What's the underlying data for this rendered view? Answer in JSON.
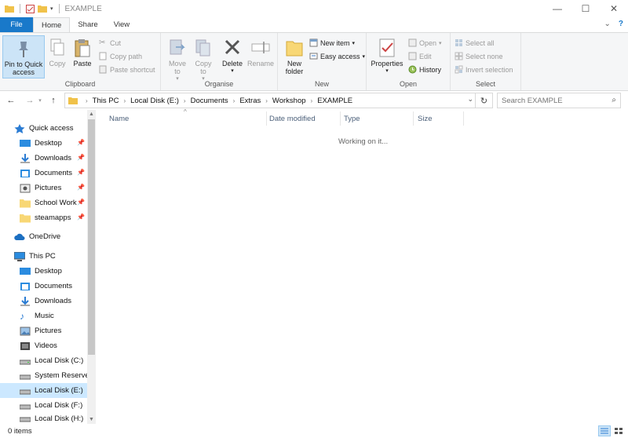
{
  "window": {
    "title": "EXAMPLE"
  },
  "tabs": [
    {
      "label": "File"
    },
    {
      "label": "Home"
    },
    {
      "label": "Share"
    },
    {
      "label": "View"
    }
  ],
  "ribbon": {
    "clipboard": {
      "label": "Clipboard",
      "pin_label": "Pin to Quick access",
      "copy_label": "Copy",
      "paste_label": "Paste",
      "cut_label": "Cut",
      "copy_path_label": "Copy path",
      "paste_shortcut_label": "Paste shortcut"
    },
    "organise": {
      "label": "Organise",
      "move_to_label": "Move to",
      "copy_to_label": "Copy to",
      "delete_label": "Delete",
      "rename_label": "Rename"
    },
    "new": {
      "label": "New",
      "new_folder_label": "New folder",
      "new_item_label": "New item",
      "easy_access_label": "Easy access"
    },
    "open": {
      "label": "Open",
      "properties_label": "Properties",
      "open_label": "Open",
      "edit_label": "Edit",
      "history_label": "History"
    },
    "select": {
      "label": "Select",
      "select_all_label": "Select all",
      "select_none_label": "Select none",
      "invert_selection_label": "Invert selection"
    }
  },
  "address": {
    "breadcrumbs": [
      "This PC",
      "Local Disk (E:)",
      "Documents",
      "Extras",
      "Workshop",
      "EXAMPLE"
    ]
  },
  "search": {
    "placeholder": "Search EXAMPLE"
  },
  "navpane": {
    "quick_access": {
      "label": "Quick access",
      "items": [
        {
          "label": "Desktop"
        },
        {
          "label": "Downloads"
        },
        {
          "label": "Documents"
        },
        {
          "label": "Pictures"
        },
        {
          "label": "School Work"
        },
        {
          "label": "steamapps"
        }
      ]
    },
    "onedrive": {
      "label": "OneDrive"
    },
    "this_pc": {
      "label": "This PC",
      "items": [
        {
          "label": "Desktop"
        },
        {
          "label": "Documents"
        },
        {
          "label": "Downloads"
        },
        {
          "label": "Music"
        },
        {
          "label": "Pictures"
        },
        {
          "label": "Videos"
        },
        {
          "label": "Local Disk (C:)"
        },
        {
          "label": "System Reserved"
        },
        {
          "label": "Local Disk (E:)"
        },
        {
          "label": "Local Disk (F:)"
        },
        {
          "label": "Local Disk (H:)"
        }
      ]
    }
  },
  "content": {
    "columns": [
      "Name",
      "Date modified",
      "Type",
      "Size"
    ],
    "status_message": "Working on it..."
  },
  "statusbar": {
    "item_count": "0 items"
  },
  "colors": {
    "file_tab": "#1979ca",
    "folder_yellow": "#f8d775",
    "selection": "#cce8ff"
  }
}
